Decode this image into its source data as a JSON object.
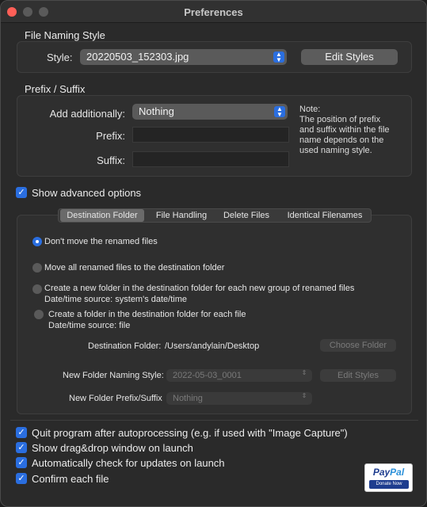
{
  "window": {
    "title": "Preferences"
  },
  "naming": {
    "section": "File Naming Style",
    "style_label": "Style:",
    "style_value": "20220503_152303.jpg",
    "edit_styles": "Edit Styles"
  },
  "prefix_suffix": {
    "section": "Prefix / Suffix",
    "add_label": "Add additionally:",
    "add_value": "Nothing",
    "prefix_label": "Prefix:",
    "suffix_label": "Suffix:",
    "prefix_value": "",
    "suffix_value": "",
    "note_title": "Note:",
    "note_lines": [
      "The position of prefix",
      "and suffix within the file",
      "name depends on the",
      "used naming style."
    ]
  },
  "advanced": {
    "label": "Show advanced options",
    "checked": true
  },
  "tabs": [
    "Destination Folder",
    "File Handling",
    "Delete Files",
    "Identical Filenames"
  ],
  "destination": {
    "options": [
      {
        "label": "Don't move the renamed files",
        "sub": ""
      },
      {
        "label": "Move all renamed files to the destination folder",
        "sub": ""
      },
      {
        "label": "Create a new folder in the destination folder for each new group of renamed files",
        "sub": "Date/time source: system's date/time"
      },
      {
        "label": "Create a folder in the destination folder for each file",
        "sub": "Date/time source: file"
      }
    ],
    "selected_index": 0,
    "folder_label": "Destination Folder:",
    "folder_value": "/Users/andylain/Desktop",
    "choose_folder": "Choose Folder",
    "naming_label": "New Folder Naming Style:",
    "naming_value": "2022-05-03_0001",
    "edit_styles": "Edit Styles",
    "prefix_label": "New Folder Prefix/Suffix",
    "prefix_value": "Nothing"
  },
  "bottom_options": [
    "Quit program after autoprocessing (e.g. if used with \"Image Capture\")",
    "Show drag&drop window on launch",
    "Automatically check for updates on launch",
    "Confirm each file"
  ],
  "paypal": {
    "brand_a": "Pay",
    "brand_b": "Pal",
    "button": "Donate Now"
  },
  "colors": {
    "accent": "#2a6ee0",
    "close": "#ff5f57"
  }
}
